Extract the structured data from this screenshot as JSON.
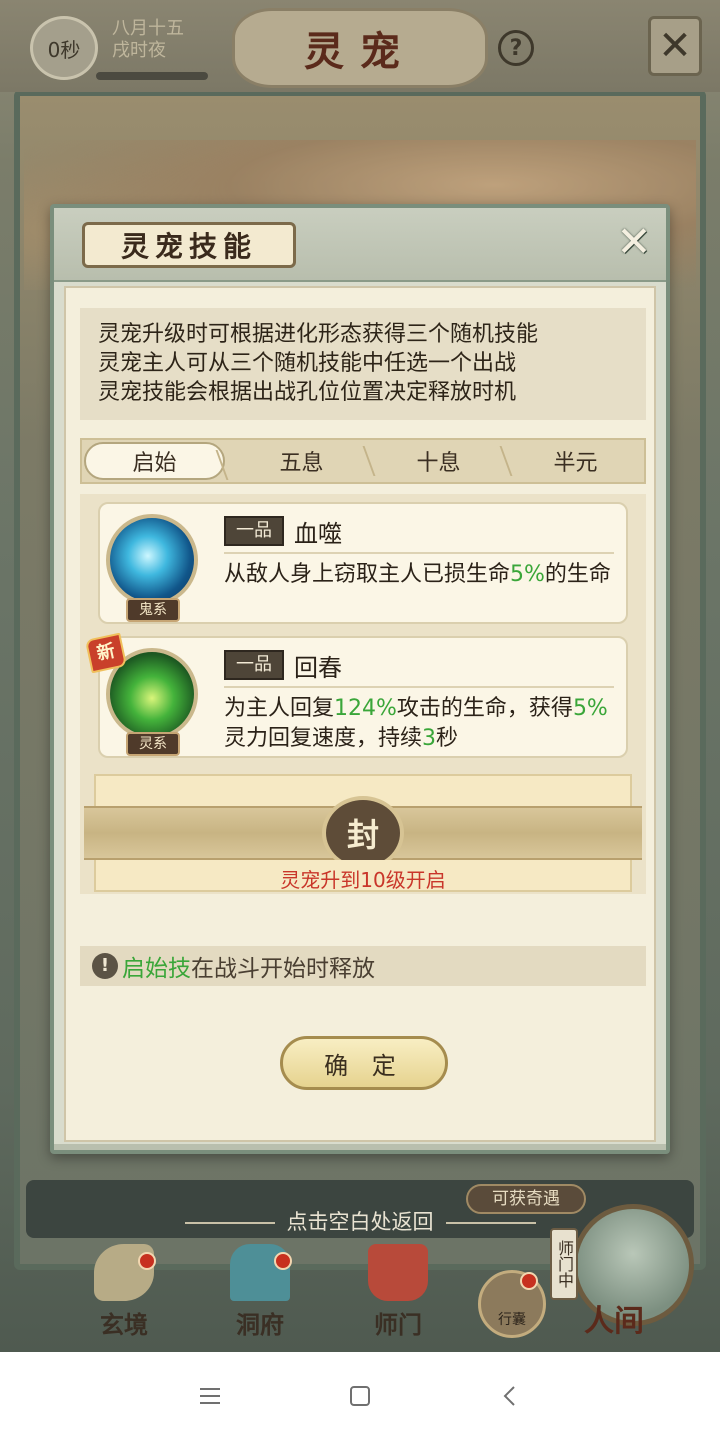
{
  "top_bar": {
    "timer": "0秒",
    "date_line1": "八月十五",
    "date_line2": "戌时夜",
    "title": "灵宠",
    "help_symbol": "?",
    "close_symbol": "✕"
  },
  "modal": {
    "title": "灵宠技能",
    "close_symbol": "✕",
    "intro_lines": [
      "灵宠升级时可根据进化形态获得三个随机技能",
      "灵宠主人可从三个随机技能中任选一个出战",
      "灵宠技能会根据出战孔位位置决定释放时机"
    ],
    "tabs": [
      {
        "label": "启始",
        "active": true
      },
      {
        "label": "五息",
        "active": false
      },
      {
        "label": "十息",
        "active": false
      },
      {
        "label": "半元",
        "active": false
      }
    ],
    "skills": [
      {
        "grade": "一品",
        "name": "血噬",
        "element_tag": "鬼系",
        "is_new": false,
        "desc_parts": [
          "从敌人身上窃取主人已损生命",
          "5%",
          "的生命"
        ]
      },
      {
        "grade": "一品",
        "name": "回春",
        "element_tag": "灵系",
        "is_new": true,
        "new_label": "新",
        "desc_parts": [
          "为主人回复",
          "124%",
          "攻击的生命，获得",
          "5%",
          "灵力回复速度，持续",
          "3",
          "秒"
        ]
      }
    ],
    "locked_slot": {
      "seal": "封",
      "text": "灵宠升到10级开启"
    },
    "note": {
      "icon": "!",
      "highlight": "启始技",
      "rest": "在战斗开始时释放"
    },
    "confirm_label": "确 定"
  },
  "bottom_hint": "点击空白处返回",
  "fortune_tag": "可获奇遇",
  "nav": {
    "items": [
      "玄境",
      "洞府",
      "师门"
    ],
    "bag_label": "行囊",
    "sect_tag": "师门中",
    "world_label": "人间"
  },
  "colors": {
    "highlight_green": "#3aa639",
    "locked_red": "#c9362a",
    "modal_frame": "#7a8e7c"
  }
}
